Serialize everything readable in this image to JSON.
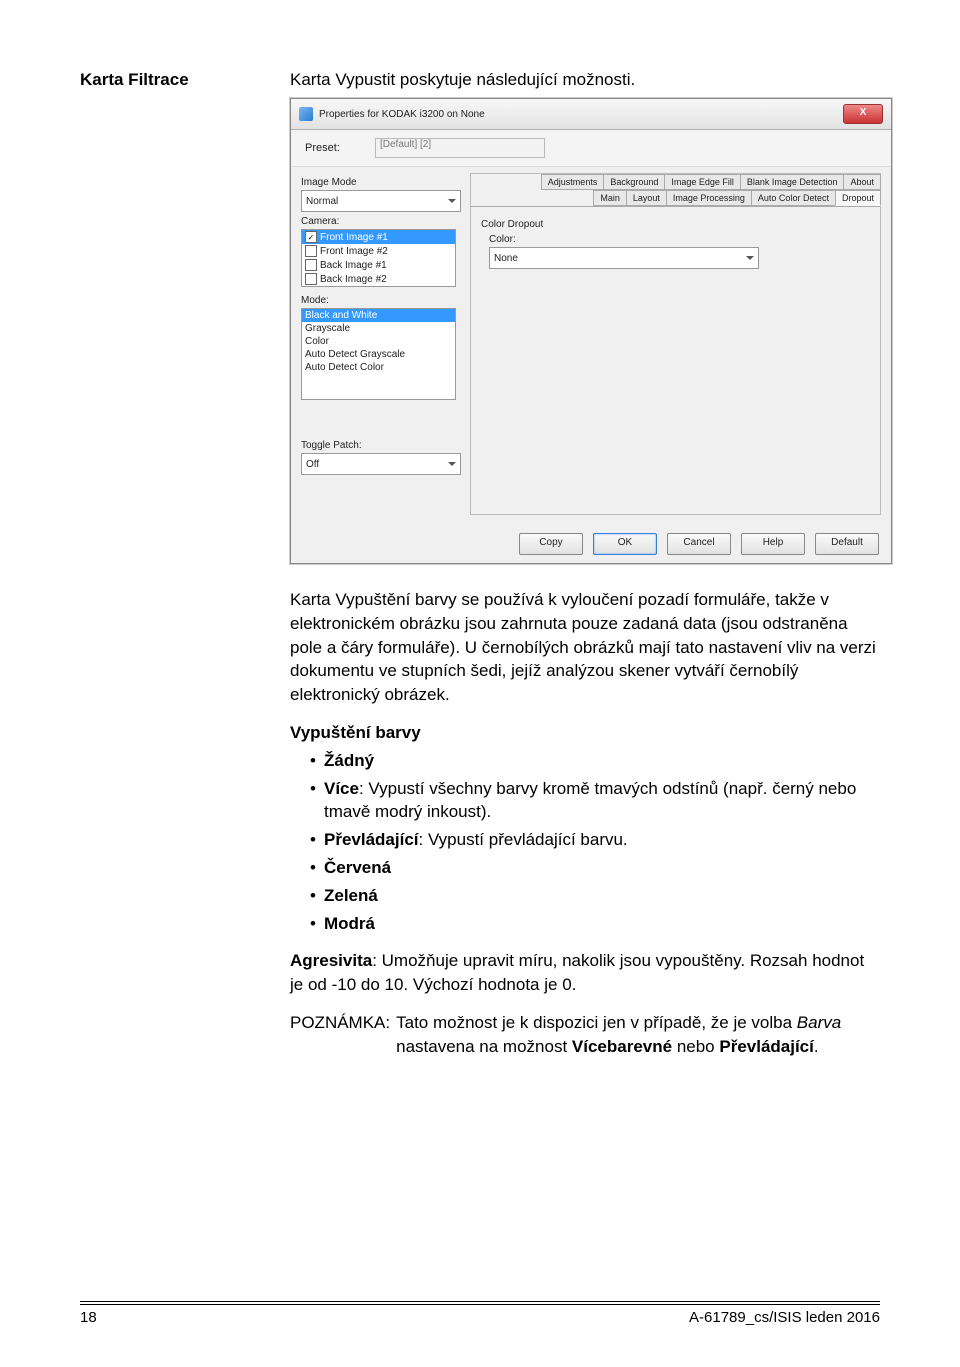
{
  "header": {
    "left_title": "Karta Filtrace",
    "right_intro": "Karta Vypustit poskytuje následující možnosti."
  },
  "dialog": {
    "title": "Properties for KODAK i3200 on None",
    "close_symbol": "X",
    "preset_label": "Preset:",
    "preset_value": "[Default] [2]",
    "image_mode_label": "Image Mode",
    "image_mode_value": "Normal",
    "camera_label": "Camera:",
    "camera_items": [
      {
        "checked": true,
        "label": "Front Image #1",
        "selected": true
      },
      {
        "checked": false,
        "label": "Front Image #2",
        "selected": false
      },
      {
        "checked": false,
        "label": "Back Image #1",
        "selected": false
      },
      {
        "checked": false,
        "label": "Back Image #2",
        "selected": false
      }
    ],
    "mode_label": "Mode:",
    "mode_items": [
      {
        "label": "Black and White",
        "selected": true
      },
      {
        "label": "Grayscale",
        "selected": false
      },
      {
        "label": "Color",
        "selected": false
      },
      {
        "label": "Auto Detect Grayscale",
        "selected": false
      },
      {
        "label": "Auto Detect Color",
        "selected": false
      }
    ],
    "toggle_patch_label": "Toggle Patch:",
    "toggle_patch_value": "Off",
    "tabs_row1": [
      "Adjustments",
      "Background",
      "Image Edge Fill",
      "Blank Image Detection",
      "About"
    ],
    "tabs_row2": [
      "Main",
      "Layout",
      "Image Processing",
      "Auto Color Detect",
      "Dropout"
    ],
    "active_tab": "Dropout",
    "color_dropout_label": "Color Dropout",
    "color_label": "Color:",
    "color_value": "None",
    "buttons": {
      "copy": "Copy",
      "ok": "OK",
      "cancel": "Cancel",
      "help": "Help",
      "default": "Default"
    }
  },
  "body": {
    "para1": "Karta Vypuštění barvy se používá k vyloučení pozadí formuláře, takže v elektronickém obrázku jsou zahrnuta pouze zadaná data (jsou odstraněna pole a čáry formuláře). U černobílých obrázků mají tato nastavení vliv na verzi dokumentu ve stupních šedi, jejíž analýzou skener vytváří černobílý elektronický obrázek.",
    "subtitle1": "Vypuštění barvy",
    "bullets1": [
      {
        "bold": "Žádný",
        "rest": ""
      },
      {
        "bold": "Více",
        "rest": ": Vypustí všechny barvy kromě tmavých odstínů (např. černý nebo tmavě modrý inkoust)."
      },
      {
        "bold": "Převládající",
        "rest": ": Vypustí převládající barvu."
      },
      {
        "bold": "Červená",
        "rest": ""
      },
      {
        "bold": "Zelená",
        "rest": ""
      },
      {
        "bold": "Modrá",
        "rest": ""
      }
    ],
    "para2_bold": "Agresivita",
    "para2_rest": ": Umožňuje upravit míru, nakolik jsou vypouštěny. Rozsah hodnot je od -10 do 10. Výchozí hodnota je 0.",
    "note_label": "POZNÁMKA:",
    "note_pre": "Tato možnost je k dispozici jen v případě, že je volba ",
    "note_italic": "Barva",
    "note_mid": " nastavena na možnost ",
    "note_bold1": "Vícebarevné",
    "note_or": " nebo ",
    "note_bold2": "Převládající",
    "note_end": "."
  },
  "footer": {
    "page": "18",
    "doc": "A-61789_cs/ISIS leden 2016"
  }
}
